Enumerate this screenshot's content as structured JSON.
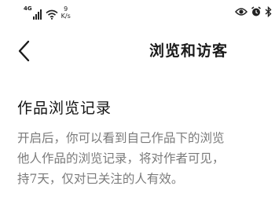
{
  "status_bar": {
    "network_type": "4G",
    "speed_value": "9",
    "speed_unit": "K/s",
    "icons": [
      "eye-icon",
      "alarm-icon",
      "bluetooth-icon"
    ]
  },
  "header": {
    "back_icon": "chevron-left-icon",
    "title": "浏览和访客"
  },
  "section": {
    "title": "作品浏览记录",
    "description_lines": [
      "开启后，你可以看到自己作品下的浏览",
      "他人作品的浏览记录，将对作者可见，",
      "持7天，仅对已关注的人有效。"
    ]
  }
}
